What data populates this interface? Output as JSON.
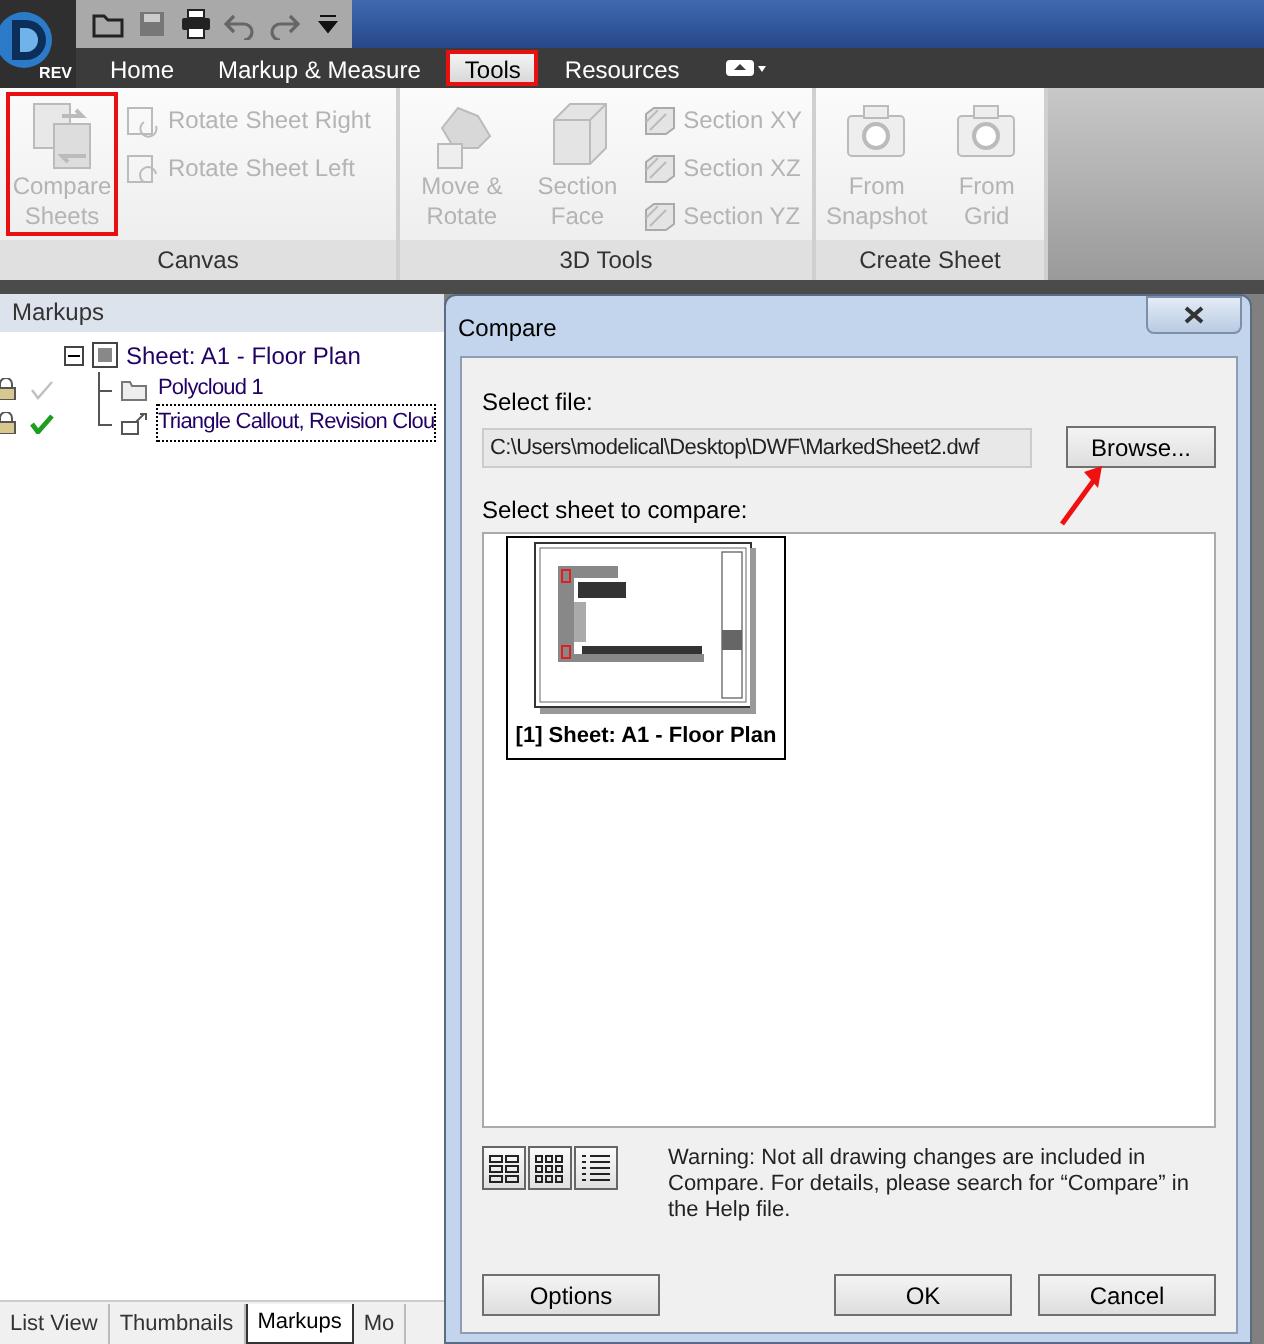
{
  "app_button": {
    "label": "REV"
  },
  "ribbon_tabs": [
    {
      "label": "Home",
      "selected": false,
      "annotated": false
    },
    {
      "label": "Markup & Measure",
      "selected": false,
      "annotated": false
    },
    {
      "label": "Tools",
      "selected": true,
      "annotated": true
    },
    {
      "label": "Resources",
      "selected": false,
      "annotated": false
    }
  ],
  "ribbon_groups": [
    {
      "title": "Canvas",
      "items": [
        {
          "kind": "large",
          "label": "Compare Sheets",
          "disabled": true,
          "annotated": true
        },
        {
          "kind": "small",
          "label": "Rotate Sheet Right",
          "disabled": true,
          "annotated": false
        },
        {
          "kind": "small",
          "label": "Rotate Sheet Left",
          "disabled": true,
          "annotated": false
        }
      ]
    },
    {
      "title": "3D Tools",
      "items": [
        {
          "kind": "large",
          "label": "Move & Rotate",
          "disabled": true,
          "annotated": false
        },
        {
          "kind": "large",
          "label": "Section Face",
          "disabled": true,
          "annotated": false
        },
        {
          "kind": "small",
          "label": "Section XY",
          "disabled": true,
          "annotated": false
        },
        {
          "kind": "small",
          "label": "Section XZ",
          "disabled": true,
          "annotated": false
        },
        {
          "kind": "small",
          "label": "Section YZ",
          "disabled": true,
          "annotated": false
        }
      ]
    },
    {
      "title": "Create Sheet",
      "items": [
        {
          "kind": "large",
          "label": "From Snapshot",
          "disabled": true,
          "annotated": false
        },
        {
          "kind": "large",
          "label": "From Grid",
          "disabled": true,
          "annotated": false
        }
      ]
    }
  ],
  "markups_panel": {
    "title": "Markups",
    "tree": [
      {
        "label": "Sheet: A1 - Floor Plan",
        "expanded": true,
        "children": [
          {
            "label": "Polycloud 1",
            "locked": true,
            "checked": false,
            "focused": false
          },
          {
            "label": "Triangle Callout, Revision Clou",
            "locked": true,
            "checked": true,
            "focused": true
          }
        ]
      }
    ]
  },
  "bottom_tabs": [
    {
      "label": "List View",
      "selected": false
    },
    {
      "label": "Thumbnails",
      "selected": false
    },
    {
      "label": "Markups",
      "selected": true
    },
    {
      "label": "Mo",
      "selected": false
    }
  ],
  "dialog": {
    "title": "Compare",
    "file_label": "Select file:",
    "file_path": "C:\\Users\\modelical\\Desktop\\DWF\\MarkedSheet2.dwf",
    "browse_button": "Browse...",
    "sheet_label": "Select sheet to compare:",
    "sheets": [
      {
        "label": "[1] Sheet: A1 - Floor Plan",
        "selected": true
      }
    ],
    "view_buttons": [
      {
        "kind": "large-grid"
      },
      {
        "kind": "small-grid"
      },
      {
        "kind": "list"
      }
    ],
    "warning": "Warning: Not all drawing changes are included in Compare.  For details, please search for “Compare” in the Help file.",
    "buttons": [
      "Options",
      "OK",
      "Cancel"
    ]
  }
}
